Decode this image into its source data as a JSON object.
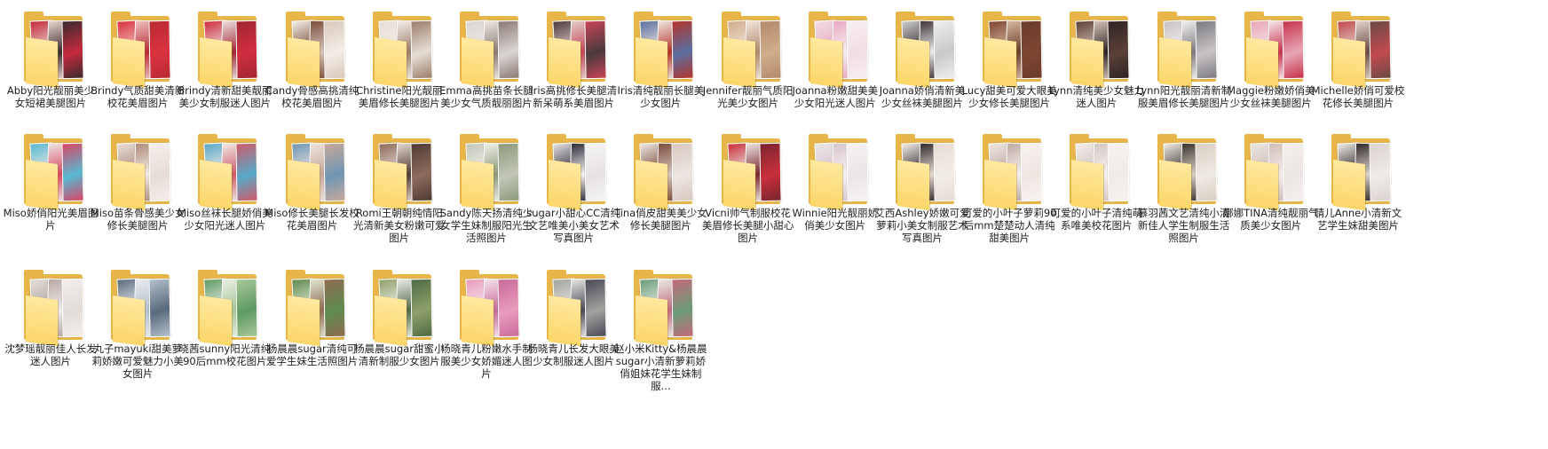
{
  "folders": [
    {
      "label": "Abby阳光靓丽美少女短裙美腿图片",
      "colors": [
        "#c42a3b",
        "#e9d6cf",
        "#3b2a2f"
      ]
    },
    {
      "label": "Brindy气质甜美清新校花美眉图片",
      "colors": [
        "#d9333f",
        "#f0c2c0",
        "#b82a35"
      ]
    },
    {
      "label": "Brindy清新甜美靓丽美少女制服迷人图片",
      "colors": [
        "#cf2e3e",
        "#ece0df",
        "#a22633"
      ]
    },
    {
      "label": "Candy骨感高挑清纯校花美眉图片",
      "colors": [
        "#f3ede6",
        "#7a4d3a",
        "#d8c8bc"
      ]
    },
    {
      "label": "Christine阳光靓丽美眉修长美腿图片",
      "colors": [
        "#e6dfd7",
        "#f4efe9",
        "#9b7d69"
      ]
    },
    {
      "label": "Emma高挑苗条长腿美少女气质靓丽图片",
      "colors": [
        "#dad6d5",
        "#efe8e2",
        "#8a7a74"
      ]
    },
    {
      "label": "Iris高挑修长美腿清新呆萌系美眉图片",
      "colors": [
        "#4b3a3d",
        "#e1ccc8",
        "#c84357"
      ]
    },
    {
      "label": "Iris清纯靓丽长腿美少女图片",
      "colors": [
        "#5b6fa0",
        "#efe7df",
        "#b3342c"
      ]
    },
    {
      "label": "Jennifer靓丽气质阳光美少女图片",
      "colors": [
        "#d1ad8c",
        "#f0e4da",
        "#b28a6d"
      ]
    },
    {
      "label": "Joanna粉嫩甜美美少女阳光迷人图片",
      "colors": [
        "#f2dde5",
        "#e9a9c2",
        "#f7f0f2"
      ]
    },
    {
      "label": "Joanna娇俏清新美少女丝袜美腿图片",
      "colors": [
        "#c9c9cb",
        "#3d3436",
        "#eeeeee"
      ]
    },
    {
      "label": "Lucy甜美可爱大眼美少女修长美腿图片",
      "colors": [
        "#7d4631",
        "#d8b8a1",
        "#6a3b2a"
      ]
    },
    {
      "label": "Lynn清纯美少女魅力迷人图片",
      "colors": [
        "#5b4037",
        "#d4c2b7",
        "#2f2424"
      ]
    },
    {
      "label": "Lynn阳光靓丽清新制服美眉修长美腿图片",
      "colors": [
        "#c8c3c6",
        "#f3f0ef",
        "#7c7b80"
      ]
    },
    {
      "label": "Maggie粉嫩娇俏美少女丝袜美腿图片",
      "colors": [
        "#e7a7b6",
        "#f5e6ea",
        "#c7324d"
      ]
    },
    {
      "label": "Michelle娇俏可爱校花修长美腿图片",
      "colors": [
        "#c24a4f",
        "#e3d2ca",
        "#6a4a44"
      ]
    },
    {
      "label": "Miso娇俏阳光美眉图片",
      "colors": [
        "#58b9d3",
        "#ede6e4",
        "#d84665"
      ]
    },
    {
      "label": "Miso苗条骨感美少女修长美腿图片",
      "colors": [
        "#e7ddd8",
        "#ae8a78",
        "#f4eeea"
      ]
    },
    {
      "label": "Miso丝袜长腿娇俏美少女阳光迷人图片",
      "colors": [
        "#57a9c8",
        "#f0e9e6",
        "#d05a6b"
      ]
    },
    {
      "label": "Miso修长美腿长发校花美眉图片",
      "colors": [
        "#6e96b4",
        "#ece3dd",
        "#c9a89a"
      ]
    },
    {
      "label": "Romi王朝朝纯情阳光清新美女粉嫩可爱图片",
      "colors": [
        "#8d6b5c",
        "#e5d7cf",
        "#4f3b34"
      ]
    },
    {
      "label": "Sandy陈天扬清纯少女学生妹制服阳光生活照图片",
      "colors": [
        "#c3c6b8",
        "#f2f0ea",
        "#8b9a7a"
      ]
    },
    {
      "label": "sugar小甜心CC清纯文艺唯美小美女艺术写真图片",
      "colors": [
        "#e6e2e4",
        "#2b2a36",
        "#f6f4f4"
      ]
    },
    {
      "label": "Tina俏皮甜美美少女修长美腿图片",
      "colors": [
        "#ece6e2",
        "#7a4b38",
        "#d8c8c0"
      ]
    },
    {
      "label": "Vicni帅气制服校花美眉修长美腿小甜心图片",
      "colors": [
        "#c8303b",
        "#efe7e1",
        "#7a2530"
      ]
    },
    {
      "label": "Winnie阳光靓丽娇俏美少女图片",
      "colors": [
        "#eae5e7",
        "#d8c5cf",
        "#f7f2f3"
      ]
    },
    {
      "label": "艾西Ashley娇嫩可爱萝莉小美女制服艺术写真图片",
      "colors": [
        "#f2ede8",
        "#2f2a2c",
        "#e8dcd5"
      ]
    },
    {
      "label": "可爱的小叶子萝莉90后mm楚楚动人清纯甜美图片",
      "colors": [
        "#efe6e2",
        "#bda9a2",
        "#f8f3f1"
      ]
    },
    {
      "label": "可爱的小叶子清纯萌系唯美校花图片",
      "colors": [
        "#f0eae8",
        "#d5c6c2",
        "#f7f3f2"
      ]
    },
    {
      "label": "慕羽茜文艺清纯小清新佳人学生制服生活照图片",
      "colors": [
        "#efeae4",
        "#39342d",
        "#d9cfc3"
      ]
    },
    {
      "label": "娜娜TINA清纯靓丽气质美少女图片",
      "colors": [
        "#ebe5e3",
        "#d0bdb5",
        "#f5f0ee"
      ]
    },
    {
      "label": "晴儿Anne小清新文艺学生妹甜美图片",
      "colors": [
        "#efebe8",
        "#2e2826",
        "#dcd3cf"
      ]
    },
    {
      "label": "沈梦瑶靓丽佳人长发迷人图片",
      "colors": [
        "#e2dcd8",
        "#b7a8a2",
        "#f2eeec"
      ]
    },
    {
      "label": "丸子mayuki甜美萝莉娇嫩可爱魅力小美女图片",
      "colors": [
        "#5a6a7d",
        "#e9ecef",
        "#b3c0cc"
      ]
    },
    {
      "label": "晓茜sunny阳光清纯90后mm校花图片",
      "colors": [
        "#5e9a62",
        "#e8efe4",
        "#a9c79a"
      ]
    },
    {
      "label": "杨晨晨sugar清纯可爱学生妹生活照图片",
      "colors": [
        "#5f8b4f",
        "#dfe6d2",
        "#8e6b50"
      ]
    },
    {
      "label": "杨晨晨sugar甜蜜小清新制服少女图片",
      "colors": [
        "#8fa06a",
        "#eeeeea",
        "#4d6a44"
      ]
    },
    {
      "label": "杨晓青儿粉嫩水手制服美少女娇媚迷人图片",
      "colors": [
        "#e99cbc",
        "#f5e5ec",
        "#c96a9a"
      ]
    },
    {
      "label": "杨晓青儿长发大眼美少女制服迷人图片",
      "colors": [
        "#a0a39e",
        "#e9e6e4",
        "#4a4a56"
      ]
    },
    {
      "label": "赵小米Kitty&杨晨晨sugar小清新萝莉娇俏姐妹花学生妹制服...",
      "colors": [
        "#6c9b78",
        "#e8ede6",
        "#c4697c"
      ]
    }
  ]
}
